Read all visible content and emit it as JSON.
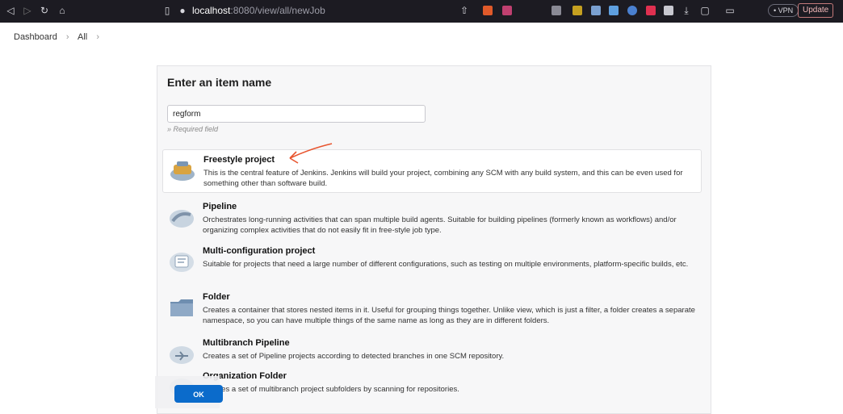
{
  "browser": {
    "url_host": "localhost",
    "url_path": ":8080/view/all/newJob",
    "vpn_label": "• VPN",
    "update_label": "Update"
  },
  "breadcrumb": {
    "items": [
      "Dashboard",
      "All"
    ]
  },
  "form": {
    "heading": "Enter an item name",
    "name_value": "regform",
    "required_hint": "» Required field",
    "ok_label": "OK"
  },
  "items": [
    {
      "title": "Freestyle project",
      "desc": "This is the central feature of Jenkins. Jenkins will build your project, combining any SCM with any build system, and this can be even used for something other than software build.",
      "icon": "freestyle-project-icon"
    },
    {
      "title": "Pipeline",
      "desc": "Orchestrates long-running activities that can span multiple build agents. Suitable for building pipelines (formerly known as workflows) and/or organizing complex activities that do not easily fit in free-style job type.",
      "icon": "pipeline-icon"
    },
    {
      "title": "Multi-configuration project",
      "desc": "Suitable for projects that need a large number of different configurations, such as testing on multiple environments, platform-specific builds, etc.",
      "icon": "multi-configuration-icon"
    },
    {
      "title": "Folder",
      "desc": "Creates a container that stores nested items in it. Useful for grouping things together. Unlike view, which is just a filter, a folder creates a separate namespace, so you can have multiple things of the same name as long as they are in different folders.",
      "icon": "folder-icon"
    },
    {
      "title": "Multibranch Pipeline",
      "desc": "Creates a set of Pipeline projects according to detected branches in one SCM repository.",
      "icon": "multibranch-pipeline-icon"
    },
    {
      "title": "Organization Folder",
      "desc": "Creates a set of multibranch project subfolders by scanning for repositories.",
      "icon": "organization-folder-icon"
    }
  ],
  "colors": {
    "accent": "#0b6bcb",
    "annotation": "#e8552f"
  }
}
